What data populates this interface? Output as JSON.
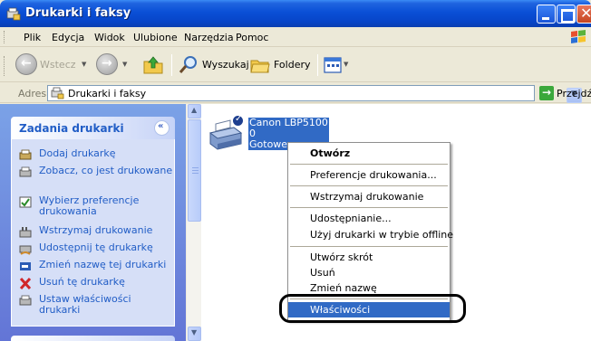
{
  "window": {
    "title": "Drukarki i faksy",
    "colors": {
      "titlebar": "#0a4fd6",
      "selection": "#316ac5",
      "task_link": "#215dc6"
    }
  },
  "menubar": {
    "items": [
      "Plik",
      "Edycja",
      "Widok",
      "Ulubione",
      "Narzędzia",
      "Pomoc"
    ]
  },
  "toolbar": {
    "back": "Wstecz",
    "search": "Wyszukaj",
    "folders": "Foldery"
  },
  "address": {
    "label": "Adres",
    "value": "Drukarki i faksy",
    "go": "Przejdź"
  },
  "taskpane": {
    "title": "Zadania drukarki",
    "collapse_symbol": "«",
    "tasks": [
      {
        "label": "Dodaj drukarkę",
        "icon": "add-printer-icon"
      },
      {
        "label": "Zobacz, co jest drukowane",
        "icon": "print-queue-icon"
      },
      {
        "label": "Wybierz preferencje drukowania",
        "icon": "preferences-icon"
      },
      {
        "label": "Wstrzymaj drukowanie",
        "icon": "pause-printer-icon"
      },
      {
        "label": "Udostępnij tę drukarkę",
        "icon": "share-printer-icon"
      },
      {
        "label": "Zmień nazwę tej drukarki",
        "icon": "rename-icon"
      },
      {
        "label": "Usuń tę drukarkę",
        "icon": "delete-icon"
      },
      {
        "label": "Ustaw właściwości drukarki",
        "icon": "properties-icon"
      }
    ]
  },
  "printer": {
    "name": "Canon LBP5100",
    "docs": "0",
    "status": "Gotowe"
  },
  "context_menu": {
    "items": [
      {
        "label": "Otwórz",
        "bold": true
      },
      {
        "label": "Preferencje drukowania..."
      },
      {
        "label": "Wstrzymaj drukowanie"
      },
      {
        "label": "Udostępnianie..."
      },
      {
        "label": "Użyj drukarki w trybie offline"
      },
      {
        "label": "Utwórz skrót"
      },
      {
        "label": "Usuń"
      },
      {
        "label": "Zmień nazwę"
      },
      {
        "label": "Właściwości",
        "selected": true
      }
    ]
  }
}
